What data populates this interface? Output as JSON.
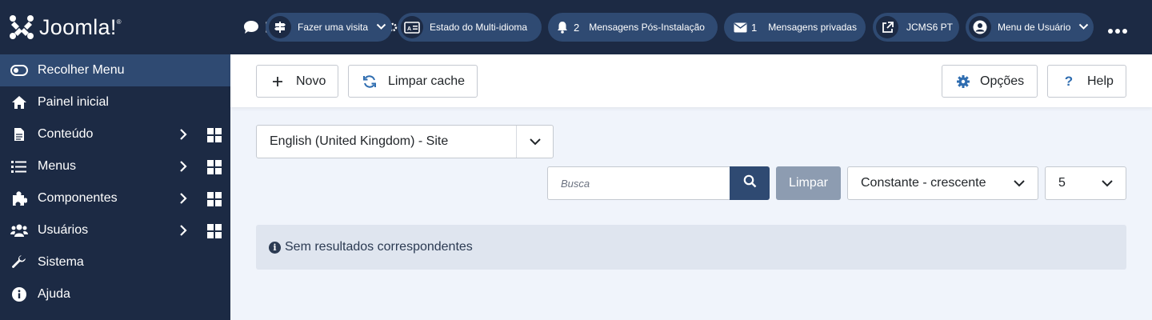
{
  "app": {
    "logo_text": "Joomla!",
    "logo_mark": "®"
  },
  "sidebar": {
    "items": [
      {
        "label": "Recolher Menu",
        "icon": "toggle-icon"
      },
      {
        "label": "Painel inicial",
        "icon": "home-icon"
      },
      {
        "label": "Conteúdo",
        "icon": "file-icon"
      },
      {
        "label": "Menus",
        "icon": "list-icon"
      },
      {
        "label": "Componentes",
        "icon": "puzzle-icon"
      },
      {
        "label": "Usuários",
        "icon": "users-icon"
      },
      {
        "label": "Sistema",
        "icon": "wrench-icon"
      },
      {
        "label": "Ajuda",
        "icon": "info-icon"
      }
    ]
  },
  "topbar": {
    "tour": {
      "label": "Fazer uma visita"
    },
    "multilang": {
      "label": "Estado do Multi-idioma"
    },
    "postinstall": {
      "count": "2",
      "label": "Mensagens Pós-Instalação"
    },
    "messages": {
      "count": "1",
      "label": "Mensagens privadas"
    },
    "site": {
      "label": "JCMS6 PT"
    },
    "user": {
      "label": "Menu de Usuário"
    }
  },
  "toolbar": {
    "new_label": "Novo",
    "clear_cache_label": "Limpar cache",
    "options_label": "Opções",
    "help_label": "Help"
  },
  "filters": {
    "language": "English (United Kingdom) - Site",
    "search_placeholder": "Busca",
    "clear_label": "Limpar",
    "ordering": "Constante - crescente",
    "limit": "5"
  },
  "alert": {
    "message": "Sem resultados correspondentes"
  },
  "colors": {
    "sidebar": "#1c2a44",
    "accent": "#2f4a72",
    "background": "#f0f4fb",
    "alert": "#dfe5ef"
  }
}
